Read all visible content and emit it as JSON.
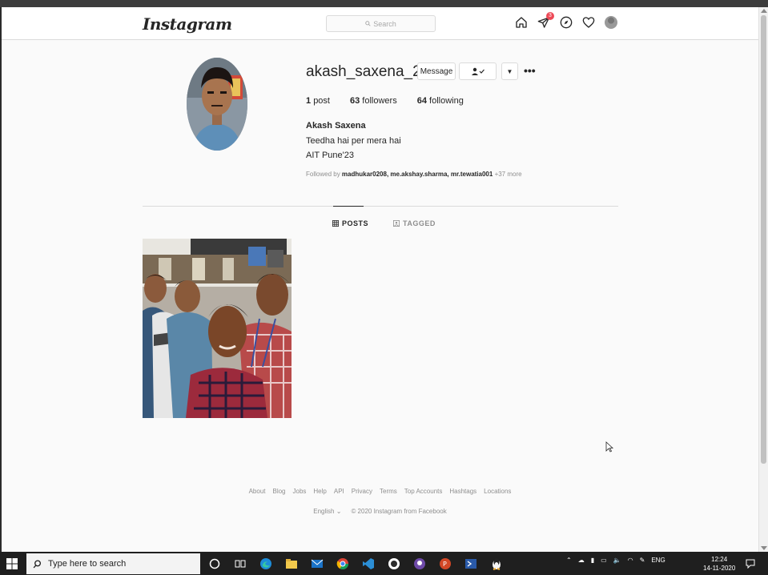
{
  "nav": {
    "logo": "Instagram",
    "search_placeholder": "Search",
    "activity_badge": "3"
  },
  "profile": {
    "username": "akash_saxena_23",
    "message_label": "Message",
    "posts_count": "1",
    "posts_label": "post",
    "followers_count": "63",
    "followers_label": "followers",
    "following_count": "64",
    "following_label": "following",
    "full_name": "Akash Saxena",
    "bio_line1": "Teedha hai per mera hai",
    "bio_line2": "AIT Pune'23",
    "followed_by_prefix": "Followed by",
    "followed_by_users": "madhukar0208, me.akshay.sharma, mr.tewatia001",
    "followed_by_more": "+37 more"
  },
  "tabs": {
    "posts": "POSTS",
    "tagged": "TAGGED"
  },
  "footer": {
    "links": [
      "About",
      "Blog",
      "Jobs",
      "Help",
      "API",
      "Privacy",
      "Terms",
      "Top Accounts",
      "Hashtags",
      "Locations"
    ],
    "language": "English",
    "copyright": "© 2020 Instagram from Facebook"
  },
  "taskbar": {
    "search_placeholder": "Type here to search",
    "language": "ENG",
    "time": "12:24",
    "date": "14-11-2020"
  },
  "colors": {
    "badge": "#ed4956",
    "text": "#262626",
    "muted": "#8e8e8e",
    "border": "#dbdbdb"
  }
}
